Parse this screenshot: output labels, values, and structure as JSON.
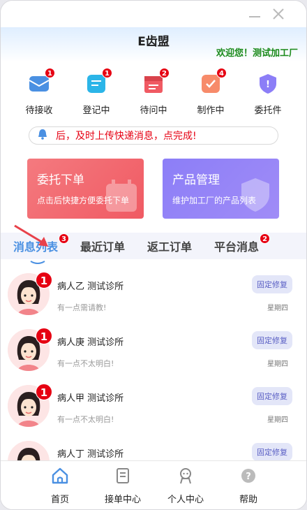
{
  "window": {
    "minimize_icon": "minimize-icon",
    "close_icon": "close-icon"
  },
  "header": {
    "title": "E齿盟",
    "welcome": "欢迎您！测试加工厂"
  },
  "quick_items": [
    {
      "label": "待接收",
      "badge": "1",
      "icon": "inbox-icon",
      "color": "#4a90e2"
    },
    {
      "label": "登记中",
      "badge": "1",
      "icon": "register-icon",
      "color": "#2bb5e8"
    },
    {
      "label": "待问中",
      "badge": "2",
      "icon": "inquiry-icon",
      "color": "#f05a63"
    },
    {
      "label": "制作中",
      "badge": "4",
      "icon": "production-icon",
      "color": "#f78b6a"
    },
    {
      "label": "委托件",
      "badge": "",
      "icon": "shield-icon",
      "color": "#8c7ef7"
    }
  ],
  "notice": {
    "text": "后，及时上传快递消息，点完成!",
    "icon": "bell-icon"
  },
  "cards": [
    {
      "title": "委托下单",
      "subtitle": "点击后快捷方便委托下单"
    },
    {
      "title": "产品管理",
      "subtitle": "维护加工厂的产品列表"
    }
  ],
  "tabs": [
    {
      "label": "消息列表",
      "badge": "3",
      "active": true
    },
    {
      "label": "最近订单",
      "badge": "",
      "active": false
    },
    {
      "label": "返工订单",
      "badge": "",
      "active": false
    },
    {
      "label": "平台消息",
      "badge": "2",
      "active": false
    }
  ],
  "messages": [
    {
      "name": "病人乙 测试诊所",
      "tag": "固定修复",
      "message": "有一点需请教!",
      "time": "星期四",
      "badge": "1"
    },
    {
      "name": "病人庚 测试诊所",
      "tag": "固定修复",
      "message": "有一点不太明白!",
      "time": "星期四",
      "badge": "1"
    },
    {
      "name": "病人甲 测试诊所",
      "tag": "固定修复",
      "message": "有一点不太明白!",
      "time": "星期四",
      "badge": "1"
    },
    {
      "name": "病人丁 测试诊所",
      "tag": "固定修复",
      "message": "",
      "time": "",
      "badge": ""
    }
  ],
  "bottom_nav": [
    {
      "label": "首页",
      "icon": "home-icon",
      "active": true
    },
    {
      "label": "接单中心",
      "icon": "orders-icon",
      "active": false
    },
    {
      "label": "个人中心",
      "icon": "profile-icon",
      "active": false
    },
    {
      "label": "帮助",
      "icon": "help-icon",
      "active": false
    }
  ],
  "colors": {
    "accent": "#4a90e2",
    "badge": "#e60012",
    "welcome": "#1a8a1a",
    "notice": "#e60012"
  }
}
